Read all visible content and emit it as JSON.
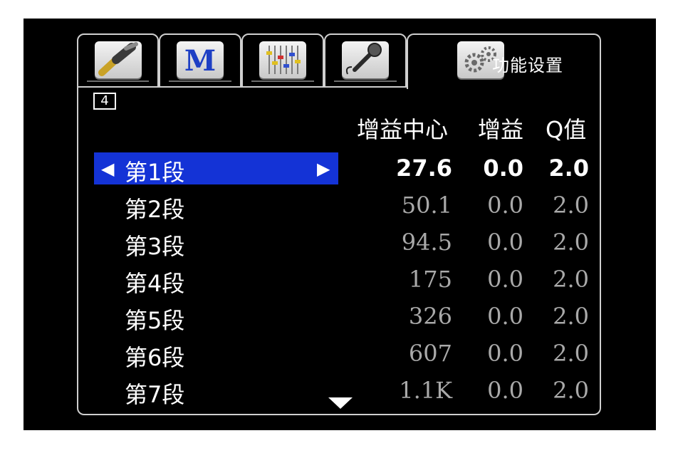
{
  "tabs": [
    {
      "name": "hdmi-cable-icon",
      "label": ""
    },
    {
      "name": "music-mode-icon",
      "label": "",
      "letter": "M"
    },
    {
      "name": "mixer-sliders-icon",
      "label": ""
    },
    {
      "name": "microphone-icon",
      "label": ""
    },
    {
      "name": "gears-icon",
      "label": "功能设置"
    }
  ],
  "page_number": "4",
  "columns": {
    "center_frequency": "增益中心",
    "gain": "增益",
    "q": "Q值"
  },
  "bands": [
    {
      "label": "第1段",
      "freq": "27.6",
      "gain": "0.0",
      "q": "2.0"
    },
    {
      "label": "第2段",
      "freq": "50.1",
      "gain": "0.0",
      "q": "2.0"
    },
    {
      "label": "第3段",
      "freq": "94.5",
      "gain": "0.0",
      "q": "2.0"
    },
    {
      "label": "第4段",
      "freq": "175",
      "gain": "0.0",
      "q": "2.0"
    },
    {
      "label": "第5段",
      "freq": "326",
      "gain": "0.0",
      "q": "2.0"
    },
    {
      "label": "第6段",
      "freq": "607",
      "gain": "0.0",
      "q": "2.0"
    },
    {
      "label": "第7段",
      "freq": "1.1K",
      "gain": "0.0",
      "q": "2.0"
    }
  ],
  "selected_band_index": 0,
  "colors": {
    "background": "#000000",
    "highlight": "#1433d6",
    "text": "#ffffff",
    "dim_text": "#a9a9a9",
    "frame": "#cfcfcf"
  }
}
